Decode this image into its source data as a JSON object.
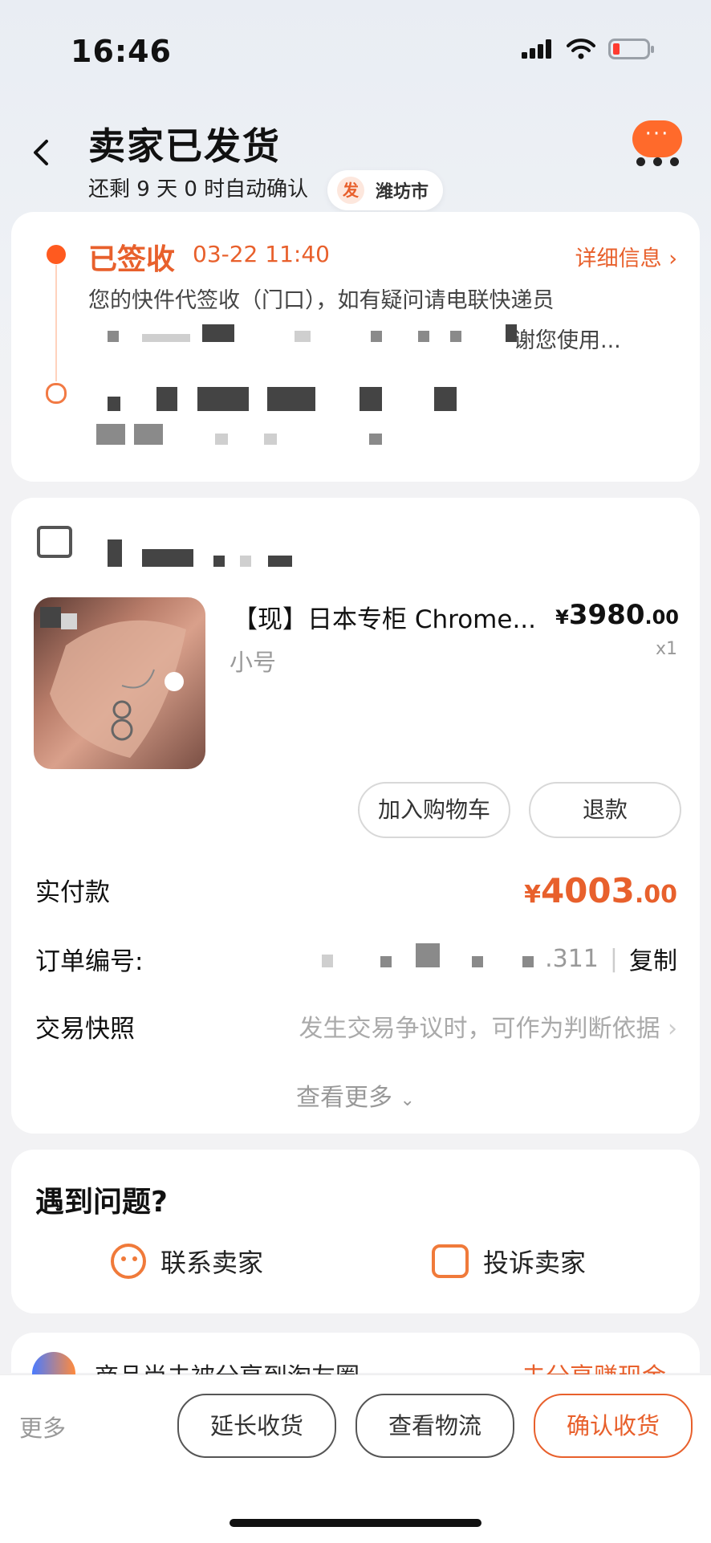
{
  "status_bar": {
    "time": "16:46"
  },
  "header": {
    "back_icon": "chevron-left-icon",
    "title": "卖家已发货",
    "subtitle": "还剩 9 天 0 时自动确认",
    "ship_from_label": "发",
    "ship_from_city": "潍坊市",
    "chat_icon": "ellipsis-chat-icon"
  },
  "logistics": {
    "status": "已签收",
    "time": "03-22 11:40",
    "detail_link": "详细信息",
    "description_line1": "您的快件代签收（门口），如有疑问请电联快递员",
    "description_line2_tail": "谢您使用..."
  },
  "order": {
    "shop_icon": "store-icon",
    "product": {
      "name": "【现】日本专柜 Chrome...",
      "price_symbol": "¥",
      "price_int": "3980",
      "price_dec": ".00",
      "spec": "小号",
      "qty": "x1"
    },
    "buttons": {
      "add_cart": "加入购物车",
      "refund": "退款"
    },
    "paid_label": "实付款",
    "paid_symbol": "¥",
    "paid_int": "4003",
    "paid_dec": ".00",
    "order_no_label": "订单编号:",
    "order_no_tail": ".311",
    "copy_label": "复制",
    "snapshot_label": "交易快照",
    "snapshot_hint": "发生交易争议时，可作为判断依据",
    "view_more": "查看更多"
  },
  "problems": {
    "title": "遇到问题?",
    "contact_seller": "联系卖家",
    "complain_seller": "投诉卖家"
  },
  "share": {
    "text": "商品尚未被分享到淘友圈",
    "cta": "去分享赚现金"
  },
  "bottom_bar": {
    "more": "更多",
    "extend": "延长收货",
    "logistics": "查看物流",
    "confirm": "确认收货"
  },
  "colors": {
    "accent": "#e8602c",
    "brand_orange": "#ff6a2b"
  }
}
